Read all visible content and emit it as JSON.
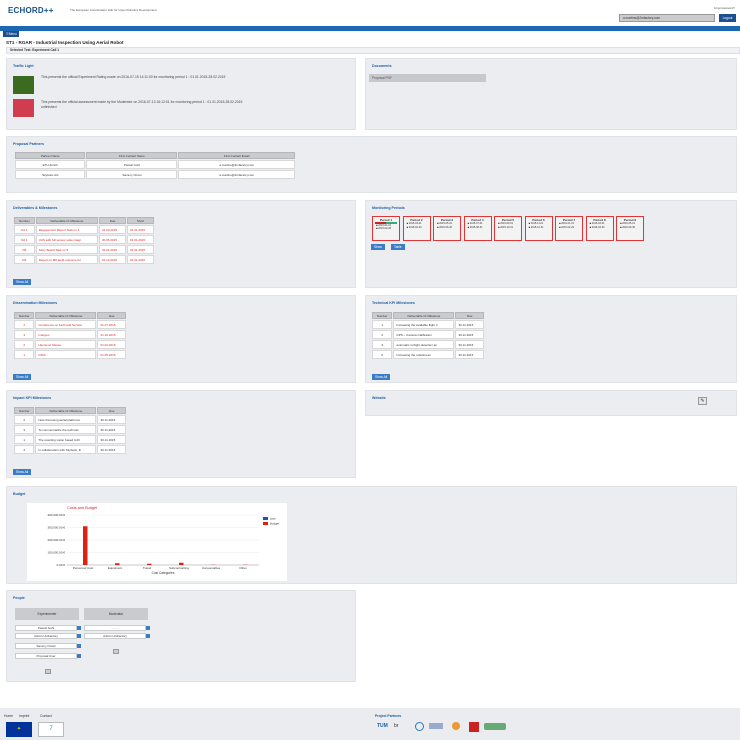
{
  "header": {
    "logo": "ECHORD++",
    "tagline": "The European Coordination Hub for Open Robotics Development",
    "forgot": "Forgot password?",
    "email": "a.martins@2mfactory.com",
    "logout": "Logout",
    "menu": "Menu"
  },
  "page_title": "ST1 - RGAR - Industrial Inspection Using Aerial Robot",
  "selector": "Selected Test: Experiment Call 1",
  "traffic": {
    "title": "Traffic Light",
    "t1": "This presents the official Experiment Rating made on 2016-07-15 14:11:00 for monitoring period 1 : 01.01.2015-28.02.2015",
    "t2": "This presents the official assessment made by the Moderator on 2016-07-13 16:12:01 for monitoring period 1 : 01.01.2015-28.02.2015",
    "t2b": "unfinished",
    "c1": "#3a6b1e",
    "c2": "#cf3d4f"
  },
  "documents": {
    "title": "Documents",
    "value": "Proposal PDF"
  },
  "partners": {
    "title": "Proposal Partners",
    "headers": [
      "Partner Name",
      "First Contact Name",
      "First Contact Email"
    ],
    "rows": [
      [
        "ETH Zurich",
        "Pascal Gohl",
        "a.martins@2mfactory.com"
      ],
      [
        "Skybotix AG",
        "Sammy Omari",
        "a.martins@2mfactory.com"
      ]
    ]
  },
  "deliverables": {
    "title": "Deliverables & Milestones",
    "headers": [
      "Number",
      "Deliverable Or Milestone",
      "Due",
      "Short"
    ],
    "rows": [
      [
        "D1.1",
        "Requirement Report Task no 1",
        "01.03.2015",
        "01.01.2015"
      ],
      [
        "D2.1",
        "UAS with full sensor suite integr.",
        "30.06.2015",
        "01.01.2015"
      ],
      [
        "D6",
        "Story Board Task no 5",
        "01.01.2015",
        "01.01.2015"
      ],
      [
        "M1",
        "Report on M# audit outcome for",
        "01.12.2015",
        "01.01.2015"
      ]
    ],
    "showall": "Show All"
  },
  "monitoring": {
    "title": "Monitoring Periods",
    "periods": [
      {
        "name": "Period 1",
        "a": "2015-01-01",
        "b": "2015-02-28"
      },
      {
        "name": "Period 2",
        "a": "2015-03-01",
        "b": "2015-04-30"
      },
      {
        "name": "Period 3",
        "a": "2015-05-01",
        "b": "2015-06-30"
      },
      {
        "name": "Period 4",
        "a": "2015-07-01",
        "b": "2015-08-31"
      },
      {
        "name": "Period 5",
        "a": "2015-09-01",
        "b": "2015-10-31"
      },
      {
        "name": "Period 6",
        "a": "2015-11-01",
        "b": "2015-12-31"
      },
      {
        "name": "Period 7",
        "a": "2016-01-01",
        "b": "2016-02-29"
      },
      {
        "name": "Period 8",
        "a": "2016-03-01",
        "b": "2016-04-30"
      },
      {
        "name": "Period 9",
        "a": "2016-05-01",
        "b": "2016-06-30"
      }
    ],
    "show": "Show",
    "table": "Table"
  },
  "dissemination": {
    "title": "Dissemination Milestones",
    "headers": [
      "Number",
      "Deliverable Or Milestone",
      "Due"
    ],
    "rows": [
      [
        "4",
        "Conference on Field and Service",
        "01.07.2015"
      ],
      [
        "3",
        "Intergeo",
        "01.10.2015"
      ],
      [
        "2",
        "Hannover Messe",
        "01.04.2016"
      ],
      [
        "1",
        "ICRA",
        "01.05.2016"
      ]
    ],
    "showall": "Show All"
  },
  "technical": {
    "title": "Technical KPI Milestones",
    "headers": [
      "Number",
      "Deliverable Or Milestone",
      "Due"
    ],
    "rows": [
      [
        "1",
        "Increasing the available flight ti",
        "30.11.2015"
      ],
      [
        "2",
        "GPS – Camera Calibration",
        "30.11.2015"
      ],
      [
        "3",
        "automatic in-flight detection an",
        "30.11.2015"
      ],
      [
        "0",
        "Increasing the robustness",
        "30.11.2015"
      ]
    ],
    "showall": "Show All"
  },
  "impact": {
    "title": "Impact KPI Milestones",
    "headers": [
      "Number",
      "Deliverable Or Milestone",
      "Due"
    ],
    "rows": [
      [
        "2",
        "Note that using aerial platforms",
        "30.11.2015"
      ],
      [
        "3",
        "To commercialize the technolo",
        "30.11.2015"
      ],
      [
        "1",
        "The resulting vision based UAV",
        "30.11.2015"
      ],
      [
        "4",
        "In collaboration with Skybotix, th",
        "30.11.2015"
      ]
    ],
    "showall": "Show All"
  },
  "website": {
    "title": "Website"
  },
  "budget": {
    "title": "Budget"
  },
  "chart_data": {
    "type": "bar",
    "title": "Costs and Budget",
    "xlabel": "Cost Categories",
    "ylabel": "",
    "categories": [
      "Personnel Cost",
      "Equipment",
      "Travel",
      "Subcontracting",
      "Consumables",
      "Other"
    ],
    "series": [
      {
        "name": "cost",
        "color": "#2255aa",
        "values": [
          0,
          0,
          0,
          0,
          0,
          0
        ]
      },
      {
        "name": "budget",
        "color": "#dd2211",
        "values": [
          310000,
          14000,
          10000,
          18000,
          2000,
          2000
        ]
      }
    ],
    "yticks": [
      "0.00 €",
      "100,000.00 €",
      "200,000.00 €",
      "300,000.00 €",
      "400,000.00 €"
    ],
    "ylim": [
      0,
      400000
    ]
  },
  "people": {
    "title": "People",
    "col1": "Experimenter",
    "col2": "Moderator",
    "exp": [
      "Pascal Gohl",
      "Admin UniFactory",
      "Sammy Omari",
      "Proposal User"
    ],
    "mod": [
      "-------",
      "Admin UniFactory"
    ]
  },
  "footer": {
    "links": [
      "Home",
      "Imprint",
      "Contact"
    ],
    "partners_title": "Project Partners",
    "partners": [
      "TUM",
      "br"
    ]
  }
}
